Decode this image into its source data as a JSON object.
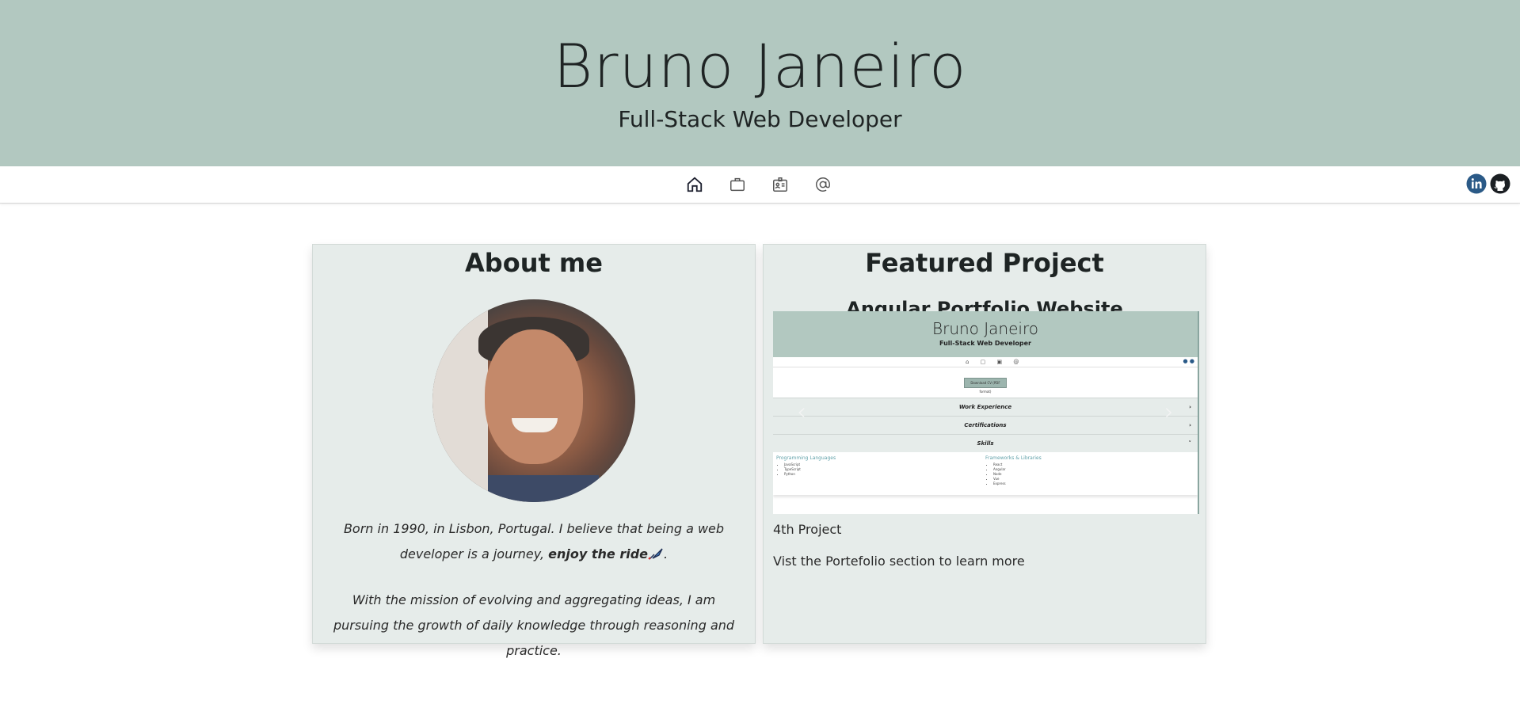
{
  "header": {
    "name": "Bruno Janeiro",
    "subtitle": "Full-Stack Web Developer"
  },
  "nav": {
    "items": [
      {
        "icon": "home-icon"
      },
      {
        "icon": "briefcase-icon"
      },
      {
        "icon": "id-card-icon"
      },
      {
        "icon": "at-sign-icon"
      }
    ],
    "social": [
      {
        "icon": "linkedin-icon"
      },
      {
        "icon": "github-icon"
      }
    ]
  },
  "about": {
    "title": "About me",
    "p1_prefix": "Born in 1990, in Lisbon, Portugal. I believe that being a web developer is a journey, ",
    "p1_bold": "enjoy the ride",
    "p1_suffix": ".",
    "p2": "With the mission of evolving and aggregating ideas, I am pursuing the growth of daily knowledge through reasoning and practice."
  },
  "project": {
    "title": "Featured Project",
    "name": "Angular Portfolio Website",
    "label": "4th Project",
    "link_text": "Vist the Portefolio section to learn more",
    "preview": {
      "name": "Bruno Janeiro",
      "subtitle": "Full-Stack Web Developer",
      "button": "Download CV (PDF format)",
      "rows": [
        "Work Experience",
        "Certifications",
        "Skills"
      ],
      "skills_left_title": "Programming Languages",
      "skills_left": [
        "JavaScript",
        "TypeScript",
        "Python"
      ],
      "skills_right_title": "Frameworks & Libraries",
      "skills_right": [
        "React",
        "Angular",
        "Node",
        "Vue",
        "Express"
      ]
    }
  },
  "colors": {
    "hero_bg": "#b2c8c0",
    "card_bg": "#e6ecea",
    "linkedin": "#2b5a87"
  }
}
